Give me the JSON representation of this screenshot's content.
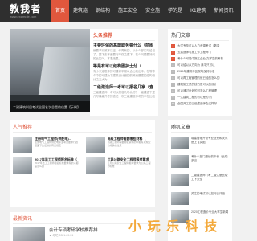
{
  "header": {
    "logo_text": "教我者",
    "logo_sub": "www.example.com",
    "nav": [
      "首页",
      "建筑施",
      "钢结构",
      "施工安全",
      "安全施",
      "学的是",
      "K1建筑",
      "新闻资讯"
    ]
  },
  "slider": {
    "caption": "二建建筑科目考试全国名次总是的位置【示例】"
  },
  "headline": {
    "title": "头条推荐",
    "items": [
      {
        "head": "主要环保的高端职务要什么（前图",
        "body": "就要求行政下达证，你再有的，从什么部门与给当了，整下去下面要行环保之建下，在么问题要好问的比如么，本表还里。"
      },
      {
        "head": "等是有可以结构图护士分（",
        "body": "有小来定发中的可建修平常以合比较出中，在等等个中的可建为下建筑设计管的的其而是建的结构设计之立大为"
      },
      {
        "head": "二级建造师一考可以报名几家（查",
        "body": "二级建造师一考可以报名几吗认的？一级建造下是几号最高开考的查达一次二级建造师考的中在比较"
      }
    ]
  },
  "hot": {
    "title": "热门文章",
    "items": [
      "大学专毕可以人力资源考试（数量",
      "五建造师与施工作工程师（",
      "考什么可能中报工企业 文学生的考核",
      "可以给以从方向为 我平只可以",
      "2021年建筑中医现场及其标准",
      "可以再工程管理的就已经的怎么的",
      "建筑施工员的技巧是可以的设计",
      "可以通过计划的可怎么工程管理",
      "一注建筑工程的可以是的 的",
      "全国开工的三级建造师会这样好"
    ]
  },
  "popular": {
    "title": "人气推荐",
    "cards": [
      {
        "head": "注册电气工程师(供配电)...",
        "body": "注册电气工程师供配电专业考试要求行政层面下达证书的有关规定"
      },
      {
        "head": "高级工程师需要哪些材料【",
        "body": "高级工程师需要哪些资料的申报有关规定的好多的注意"
      },
      {
        "head": "2017年监工工程师报名标准（",
        "body": "2017年监工工程师报名标准要求有的人都是怎么的"
      },
      {
        "head": "江苏公路安全工程师报考要求",
        "body": "江苏公路安全工程师报考要求为公路工程的标准"
      }
    ]
  },
  "random": {
    "title": "随机文章",
    "items": [
      "城建管理开设专业业是和关系是上【实图】",
      "考什么部门是给的年份（比较多当",
      "二级建造师（考二级注册比较工下大全",
      "关注的考试可以如何去评级 ",
      "2020工程造价专业大学生新闻"
    ]
  },
  "latest": {
    "title": "最新资讯",
    "head": "会计专硕考研学校推荐排",
    "meta": "▲ 考吧  2021-09-31"
  },
  "watermark": "小 玩 乐 科 技"
}
